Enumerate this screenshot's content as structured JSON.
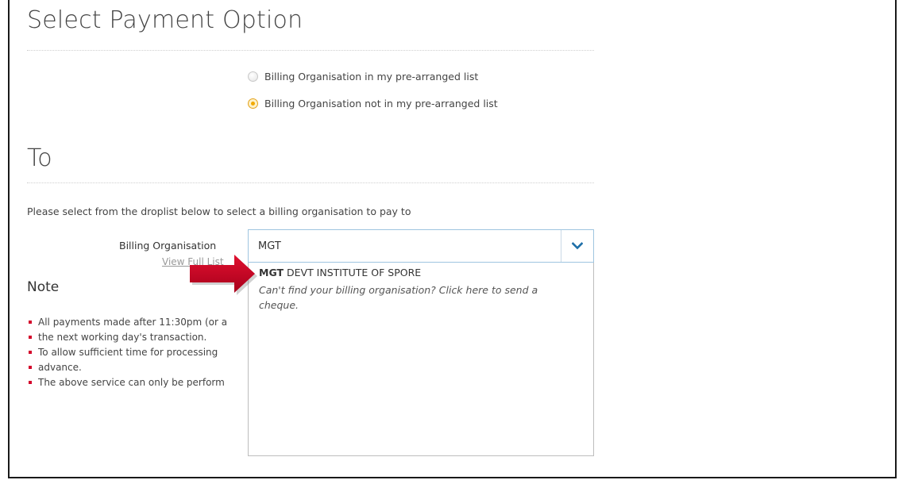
{
  "page": {
    "title": "Select Payment Option",
    "to_heading": "To",
    "instruction": "Please select from the droplist below to select a billing organisation to pay to"
  },
  "radio_options": [
    {
      "label": "Billing Organisation in my pre-arranged list",
      "selected": false
    },
    {
      "label": "Billing Organisation not in my pre-arranged list",
      "selected": true
    }
  ],
  "billing_field": {
    "label": "Billing Organisation",
    "value": "MGT",
    "view_link": "View Full List",
    "dropdown_icon": "chevron-down-icon"
  },
  "dropdown": {
    "match_highlight": "MGT",
    "match_rest": " DEVT INSTITUTE OF SPORE",
    "cheque_option": "Can't find your billing organisation? Click here to send a cheque."
  },
  "note": {
    "title": "Note",
    "items": [
      "All payments made after 11:30pm (or a",
      "the next working day's transaction.",
      "To allow sufficient time for processing",
      "advance.",
      "The above service can only be perform"
    ]
  },
  "colors": {
    "accent_blue": "#1e6fa8",
    "radio_selected": "#f2a900",
    "bullet_red": "#d4002a",
    "arrow_red": "#c8102e"
  }
}
